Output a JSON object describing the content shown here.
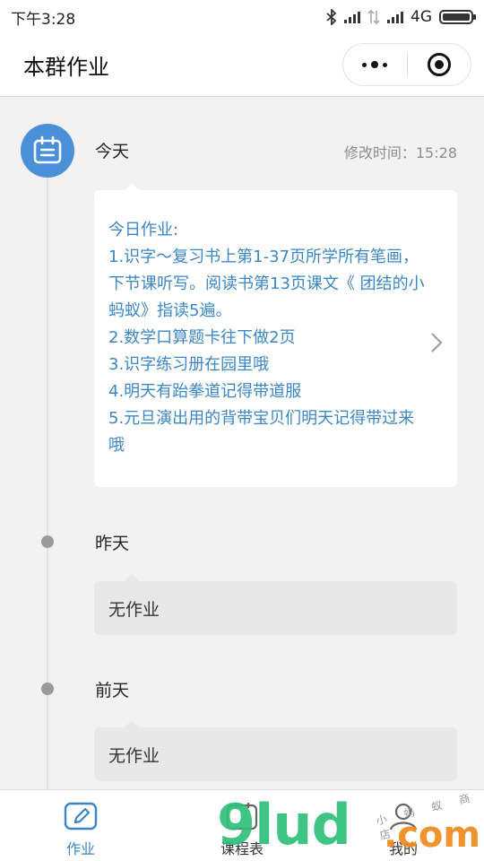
{
  "status_bar": {
    "time": "下午3:28",
    "network": "4G"
  },
  "header": {
    "title": "本群作业"
  },
  "timeline": {
    "today": {
      "label": "今天",
      "modified": "修改时间：15:28",
      "lines": [
        "今日作业:",
        "1.识字～复习书上第1-37页所学所有笔画，下节课听写。阅读书第13页课文《 团结的小蚂蚁》指读5遍。",
        "2.数学口算题卡往下做2页",
        "3.识字练习册在园里哦",
        "4.明天有跆拳道记得带道服",
        "5.元旦演出用的背带宝贝们明天记得带过来哦"
      ]
    },
    "yesterday": {
      "label": "昨天",
      "content": "无作业"
    },
    "day_before": {
      "label": "前天",
      "content": "无作业"
    }
  },
  "bottom_nav": {
    "items": [
      {
        "label": "作业",
        "icon": "edit-icon",
        "active": true
      },
      {
        "label": "课程表",
        "icon": "calendar-icon",
        "active": false
      },
      {
        "label": "我的",
        "icon": "user-icon",
        "active": false
      }
    ]
  },
  "watermark": {
    "text": "9lud",
    "suffix": ".com",
    "small": "小 蚂 蚁 商 店"
  },
  "colors": {
    "accent": "#3c86c6",
    "badge": "#4a90d9",
    "background": "#f2f2f2"
  }
}
